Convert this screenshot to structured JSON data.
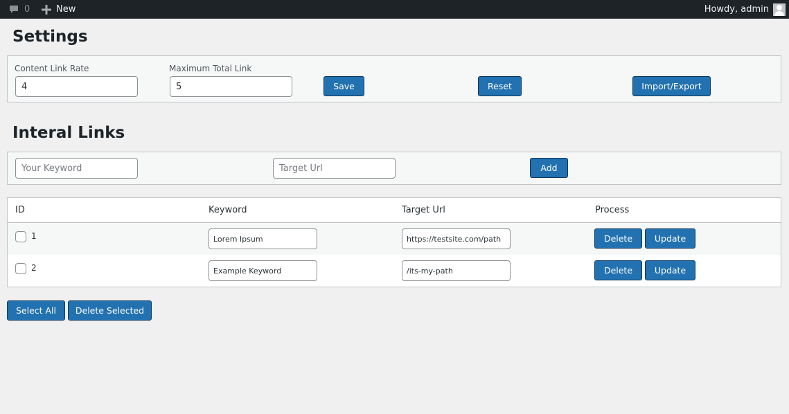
{
  "admin_bar": {
    "comments_count": "0",
    "new_label": "New",
    "howdy": "Howdy, admin"
  },
  "settings": {
    "title": "Settings",
    "content_link_rate": {
      "label": "Content Link Rate",
      "value": "4"
    },
    "maximum_total_link": {
      "label": "Maximum Total Link",
      "value": "5"
    },
    "save_label": "Save",
    "reset_label": "Reset",
    "import_export_label": "Import/Export"
  },
  "internal_links": {
    "title": "Interal Links",
    "keyword_placeholder": "Your Keyword",
    "target_url_placeholder": "Target Url",
    "add_label": "Add"
  },
  "table": {
    "headers": {
      "id": "ID",
      "keyword": "Keyword",
      "target_url": "Target Url",
      "process": "Process"
    },
    "rows": [
      {
        "id": "1",
        "keyword": "Lorem Ipsum",
        "target_url": "https://testsite.com/path",
        "delete_label": "Delete",
        "update_label": "Update"
      },
      {
        "id": "2",
        "keyword": "Example Keyword",
        "target_url": "/its-my-path",
        "delete_label": "Delete",
        "update_label": "Update"
      }
    ]
  },
  "bulk": {
    "select_all_label": "Select All",
    "delete_selected_label": "Delete Selected"
  },
  "colors": {
    "primary": "#2271b1",
    "admin_bar": "#1d2327",
    "background": "#f0f0f1"
  },
  "icons": [
    "comment-icon",
    "plus-icon",
    "avatar-icon"
  ]
}
